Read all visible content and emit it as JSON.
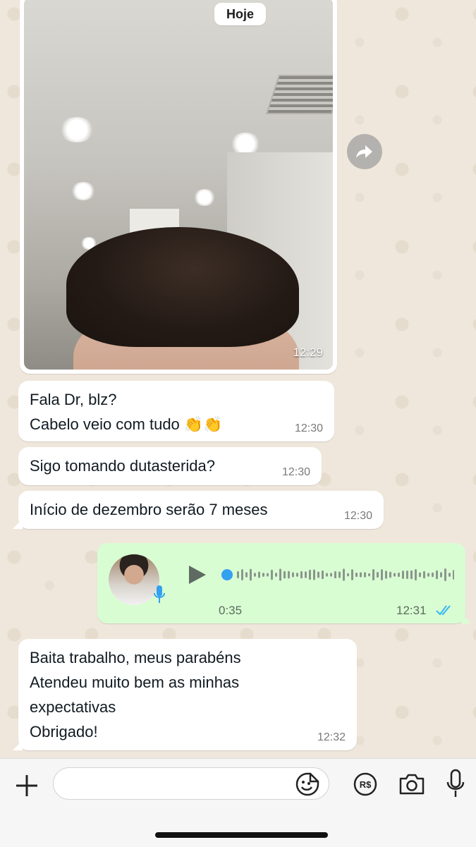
{
  "date_chip": "Hoje",
  "image_message": {
    "time": "12:29"
  },
  "messages": [
    {
      "text": "Fala Dr, blz?\nCabelo veio com tudo 👏👏",
      "time": "12:30"
    },
    {
      "text": "Sigo tomando dutasterida?",
      "time": "12:30"
    },
    {
      "text": "Início de dezembro serão 7 meses",
      "time": "12:30"
    }
  ],
  "audio_message": {
    "duration": "0:35",
    "time": "12:31",
    "status": "read"
  },
  "reply_message": {
    "text": "Baita trabalho, meus parabéns\nAtendeu muito bem as minhas\nexpectativas\nObrigado!",
    "time": "12:32"
  },
  "input": {
    "placeholder": ""
  },
  "colors": {
    "chat_background": "#efe7dc",
    "incoming_bubble": "#ffffff",
    "outgoing_bubble": "#d9fdd3",
    "read_tick": "#34b7f1",
    "play_progress": "#34a0f0"
  },
  "icons": {
    "forward": "forward-arrow-icon",
    "plus": "plus-icon",
    "sticker": "sticker-icon",
    "payment": "rs-payment-icon",
    "camera": "camera-icon",
    "mic": "microphone-icon",
    "play": "play-icon"
  }
}
